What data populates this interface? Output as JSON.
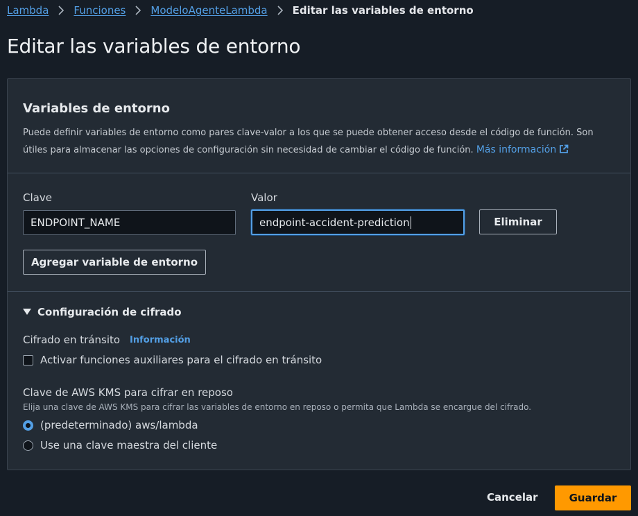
{
  "breadcrumb": {
    "items": [
      "Lambda",
      "Funciones",
      "ModeloAgenteLambda"
    ],
    "current": "Editar las variables de entorno"
  },
  "page_title": "Editar las variables de entorno",
  "env_section": {
    "title": "Variables de entorno",
    "description": "Puede definir variables de entorno como pares clave-valor a los que se puede obtener acceso desde el código de función. Son útiles para almacenar las opciones de configuración sin necesidad de cambiar el código de función.",
    "more_info_link": "Más información",
    "key_label": "Clave",
    "value_label": "Valor",
    "key_value": "ENDPOINT_NAME",
    "value_value": "endpoint-accident-prediction",
    "remove_button": "Eliminar",
    "add_button": "Agregar variable de entorno"
  },
  "encryption": {
    "expander_label": "Configuración de cifrado",
    "transit_label": "Cifrado en tránsito",
    "info_link": "Información",
    "transit_checkbox_label": "Activar funciones auxiliares para el cifrado en tránsito",
    "kms_label": "Clave de AWS KMS para cifrar en reposo",
    "kms_description": "Elija una clave de AWS KMS para cifrar las variables de entorno en reposo o permita que Lambda se encargue del cifrado.",
    "radio_default": "(predeterminado) aws/lambda",
    "radio_custom": "Use una clave maestra del cliente",
    "selected": "default"
  },
  "footer": {
    "cancel": "Cancelar",
    "save": "Guardar"
  },
  "colors": {
    "accent_link": "#539fe5",
    "primary_button": "#ff9900",
    "background": "#161d26",
    "panel": "#232b34"
  }
}
